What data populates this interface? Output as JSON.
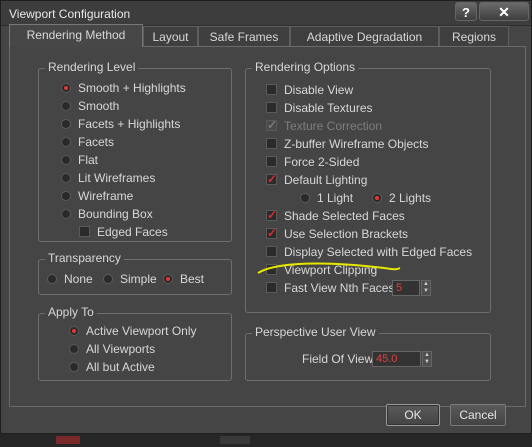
{
  "window": {
    "title": "Viewport Configuration",
    "help_label": "?",
    "close_label": "✕"
  },
  "tabs": [
    {
      "label": "Rendering Method",
      "active": true
    },
    {
      "label": "Layout",
      "active": false
    },
    {
      "label": "Safe Frames",
      "active": false
    },
    {
      "label": "Adaptive Degradation",
      "active": false
    },
    {
      "label": "Regions",
      "active": false
    }
  ],
  "rendering_level": {
    "legend": "Rendering Level",
    "options": [
      {
        "label": "Smooth + Highlights",
        "selected": true
      },
      {
        "label": "Smooth",
        "selected": false
      },
      {
        "label": "Facets + Highlights",
        "selected": false
      },
      {
        "label": "Facets",
        "selected": false
      },
      {
        "label": "Flat",
        "selected": false
      },
      {
        "label": "Lit Wireframes",
        "selected": false
      },
      {
        "label": "Wireframe",
        "selected": false
      },
      {
        "label": "Bounding Box",
        "selected": false
      }
    ],
    "edged_faces": {
      "label": "Edged Faces",
      "checked": false
    }
  },
  "transparency": {
    "legend": "Transparency",
    "options": [
      {
        "label": "None",
        "selected": false
      },
      {
        "label": "Simple",
        "selected": false
      },
      {
        "label": "Best",
        "selected": true
      }
    ]
  },
  "apply_to": {
    "legend": "Apply To",
    "options": [
      {
        "label": "Active Viewport Only",
        "selected": true
      },
      {
        "label": "All Viewports",
        "selected": false
      },
      {
        "label": "All but Active",
        "selected": false
      }
    ]
  },
  "rendering_options": {
    "legend": "Rendering Options",
    "items": [
      {
        "label": "Disable View",
        "checked": false,
        "enabled": true
      },
      {
        "label": "Disable Textures",
        "checked": false,
        "enabled": true
      },
      {
        "label": "Texture Correction",
        "checked": true,
        "enabled": false
      },
      {
        "label": "Z-buffer Wireframe Objects",
        "checked": false,
        "enabled": true
      },
      {
        "label": "Force 2-Sided",
        "checked": false,
        "enabled": true
      },
      {
        "label": "Default Lighting",
        "checked": true,
        "enabled": true
      },
      {
        "label": "Shade Selected Faces",
        "checked": true,
        "enabled": true
      },
      {
        "label": "Use Selection Brackets",
        "checked": true,
        "enabled": true
      },
      {
        "label": "Display Selected with Edged Faces",
        "checked": false,
        "enabled": true
      },
      {
        "label": "Viewport Clipping",
        "checked": false,
        "enabled": true
      },
      {
        "label": "Fast View Nth Faces:",
        "checked": false,
        "enabled": true
      }
    ],
    "lights": [
      {
        "label": "1 Light",
        "selected": false
      },
      {
        "label": "2 Lights",
        "selected": true
      }
    ],
    "nth_faces_value": "5"
  },
  "perspective": {
    "legend": "Perspective User View",
    "fov_label": "Field Of View:",
    "fov_value": "45.0"
  },
  "buttons": {
    "ok": "OK",
    "cancel": "Cancel"
  },
  "colors": {
    "accent_red": "#e02a2a",
    "highlight_annotation": "#e6e600",
    "background": "#454545"
  }
}
